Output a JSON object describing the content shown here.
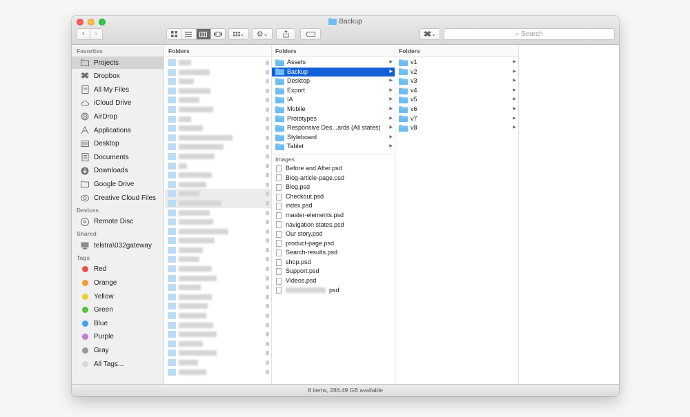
{
  "window": {
    "title": "Backup",
    "search_placeholder": "Search",
    "status": "8 items, 286.49 GB available"
  },
  "toolbar": {
    "back": "‹",
    "forward": "›",
    "arrange_caret": "⌄",
    "action_caret": "⌄"
  },
  "sidebar": {
    "favorites_label": "Favorites",
    "favorites": [
      {
        "label": "Projects",
        "icon": "folder-icon"
      },
      {
        "label": "Dropbox",
        "icon": "dropbox-icon"
      },
      {
        "label": "All My Files",
        "icon": "all-files-icon"
      },
      {
        "label": "iCloud Drive",
        "icon": "cloud-icon"
      },
      {
        "label": "AirDrop",
        "icon": "airdrop-icon"
      },
      {
        "label": "Applications",
        "icon": "applications-icon"
      },
      {
        "label": "Desktop",
        "icon": "desktop-icon"
      },
      {
        "label": "Documents",
        "icon": "documents-icon"
      },
      {
        "label": "Downloads",
        "icon": "downloads-icon"
      },
      {
        "label": "Google Drive",
        "icon": "folder-icon"
      },
      {
        "label": "Creative Cloud Files",
        "icon": "creative-cloud-icon"
      }
    ],
    "devices_label": "Devices",
    "devices": [
      {
        "label": "Remote Disc",
        "icon": "disc-icon"
      }
    ],
    "shared_label": "Shared",
    "shared": [
      {
        "label": "telstra\\032gateway",
        "icon": "monitor-icon"
      }
    ],
    "tags_label": "Tags",
    "tags": [
      {
        "label": "Red",
        "color": "#f0504c"
      },
      {
        "label": "Orange",
        "color": "#f49a32"
      },
      {
        "label": "Yellow",
        "color": "#f5cc2e"
      },
      {
        "label": "Green",
        "color": "#52c240"
      },
      {
        "label": "Blue",
        "color": "#3ba2f2"
      },
      {
        "label": "Purple",
        "color": "#c27ad8"
      },
      {
        "label": "Gray",
        "color": "#9a9a9a"
      },
      {
        "label": "All Tags...",
        "color": "#d8d8d8"
      }
    ]
  },
  "columns": {
    "col1": {
      "header": "Folders"
    },
    "col2": {
      "header": "Folders",
      "folders": [
        "Assets",
        "Backup",
        "Desktop",
        "Export",
        "IA",
        "Mobile",
        "Prototypes",
        "Responsive Des...ards (All states)",
        "Styleboard",
        "Tablet"
      ],
      "selected": "Backup",
      "images_header": "Images",
      "images": [
        "Before and After.psd",
        "Blog-article-page.psd",
        "Blog.psd",
        "Checkout.psd",
        "index.psd",
        "master-elements.psd",
        "navigation states.psd",
        "Our story.psd",
        "product-page.psd",
        "Search-results.psd",
        "shop.psd",
        "Support.psd",
        "Videos.psd",
        "psd"
      ]
    },
    "col3": {
      "header": "Folders",
      "folders": [
        "v1",
        "v2",
        "v3",
        "v4",
        "v5",
        "v6",
        "v7",
        "v8"
      ]
    }
  },
  "colors": {
    "selection": "#1360d8",
    "folder": "#6cbdf2"
  }
}
